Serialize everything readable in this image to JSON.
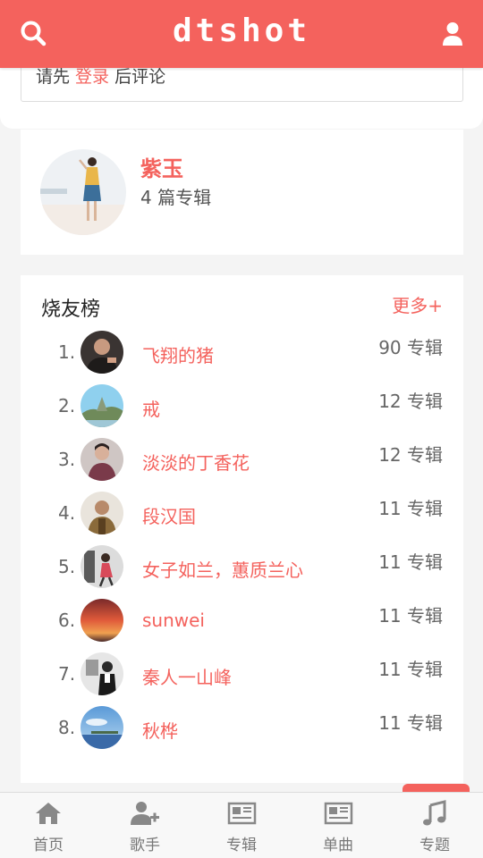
{
  "header": {
    "logo": "dtshot",
    "brand_color": "#f4625d"
  },
  "comment": {
    "prompt_before": "请先 ",
    "login_link": "登录",
    "prompt_after": " 后评论"
  },
  "artist": {
    "name": "紫玉",
    "album_count": "4 篇专辑"
  },
  "ranking": {
    "title": "烧友榜",
    "more_label": "更多+",
    "items": [
      {
        "rank": "1.",
        "name": "飞翔的猪",
        "albums": "90 专辑"
      },
      {
        "rank": "2.",
        "name": "戒",
        "albums": "12 专辑"
      },
      {
        "rank": "3.",
        "name": "淡淡的丁香花",
        "albums": "12 专辑"
      },
      {
        "rank": "4.",
        "name": "段汉国",
        "albums": "11 专辑"
      },
      {
        "rank": "5.",
        "name": "女子如兰，蕙质兰心",
        "albums": "11 专辑"
      },
      {
        "rank": "6.",
        "name": "sunwei",
        "albums": "11 专辑"
      },
      {
        "rank": "7.",
        "name": "秦人一山峰",
        "albums": "11 专辑"
      },
      {
        "rank": "8.",
        "name": "秋桦",
        "albums": "11 专辑"
      }
    ]
  },
  "nav": {
    "items": [
      {
        "label": "首页",
        "icon": "home-icon"
      },
      {
        "label": "歌手",
        "icon": "add-user-icon"
      },
      {
        "label": "专辑",
        "icon": "newspaper-icon"
      },
      {
        "label": "单曲",
        "icon": "newspaper-icon"
      },
      {
        "label": "专题",
        "icon": "music-note-icon"
      }
    ]
  }
}
